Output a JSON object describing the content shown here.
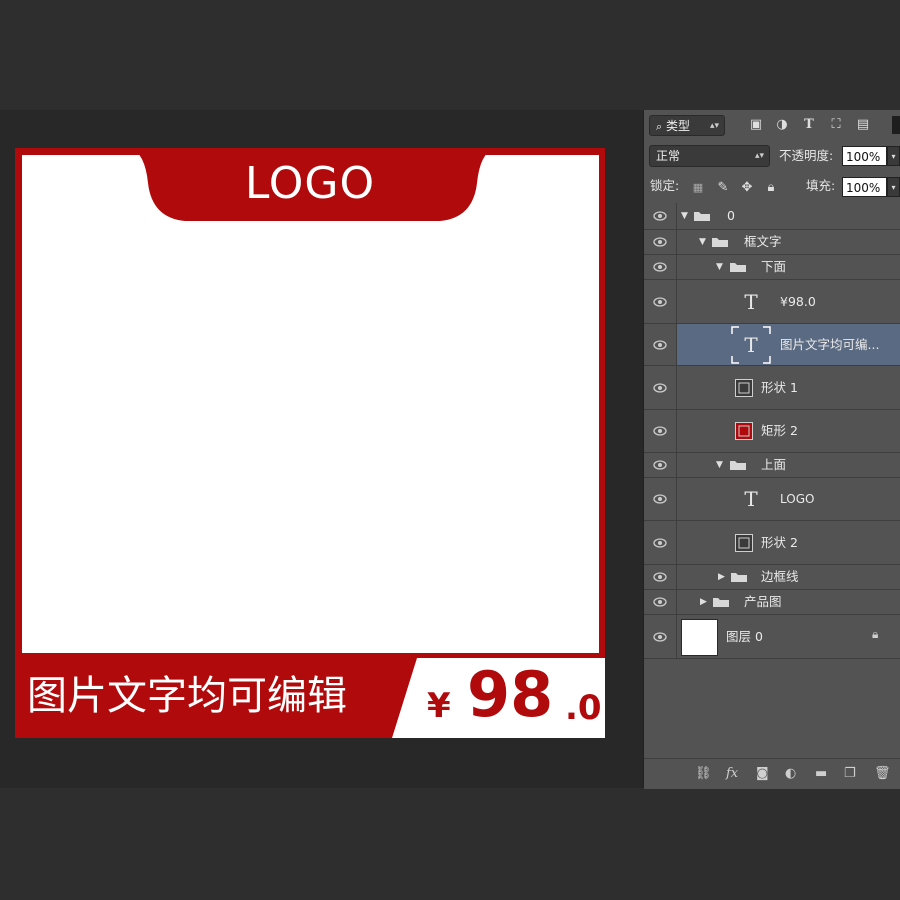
{
  "canvas": {
    "logo_text": "LOGO",
    "banner_text": "图片文字均可编辑",
    "price_currency": "¥",
    "price_main": "98",
    "price_decimal": ".0",
    "colors": {
      "brand_red": "#b00a0c",
      "white": "#ffffff"
    }
  },
  "panel": {
    "filter_select": "类型",
    "blend_select": "正常",
    "opacity_label": "不透明度:",
    "opacity_value": "100%",
    "lock_label": "锁定:",
    "fill_label": "填充:",
    "fill_value": "100%",
    "layers": [
      {
        "name": "0",
        "kind": "group"
      },
      {
        "name": "框文字",
        "kind": "group"
      },
      {
        "name": "下面",
        "kind": "group"
      },
      {
        "name": "¥98.0",
        "kind": "text"
      },
      {
        "name": "图片文字均可编...",
        "kind": "text",
        "selected": true
      },
      {
        "name": "形状 1",
        "kind": "shape"
      },
      {
        "name": "矩形 2",
        "kind": "shape"
      },
      {
        "name": "上面",
        "kind": "group"
      },
      {
        "name": "LOGO",
        "kind": "text"
      },
      {
        "name": "形状 2",
        "kind": "shape"
      },
      {
        "name": "边框线",
        "kind": "group"
      },
      {
        "name": "产品图",
        "kind": "group"
      },
      {
        "name": "图层 0",
        "kind": "pixel",
        "locked": true
      }
    ],
    "filter_icons": [
      "image-filter-icon",
      "adjustment-filter-icon",
      "type-filter-icon",
      "shape-filter-icon",
      "smart-object-filter-icon"
    ],
    "bottom_icons": [
      "link-icon",
      "fx-icon",
      "mask-icon",
      "adjustment-icon",
      "new-group-icon",
      "new-layer-icon",
      "trash-icon"
    ],
    "fx_label": "fx"
  }
}
